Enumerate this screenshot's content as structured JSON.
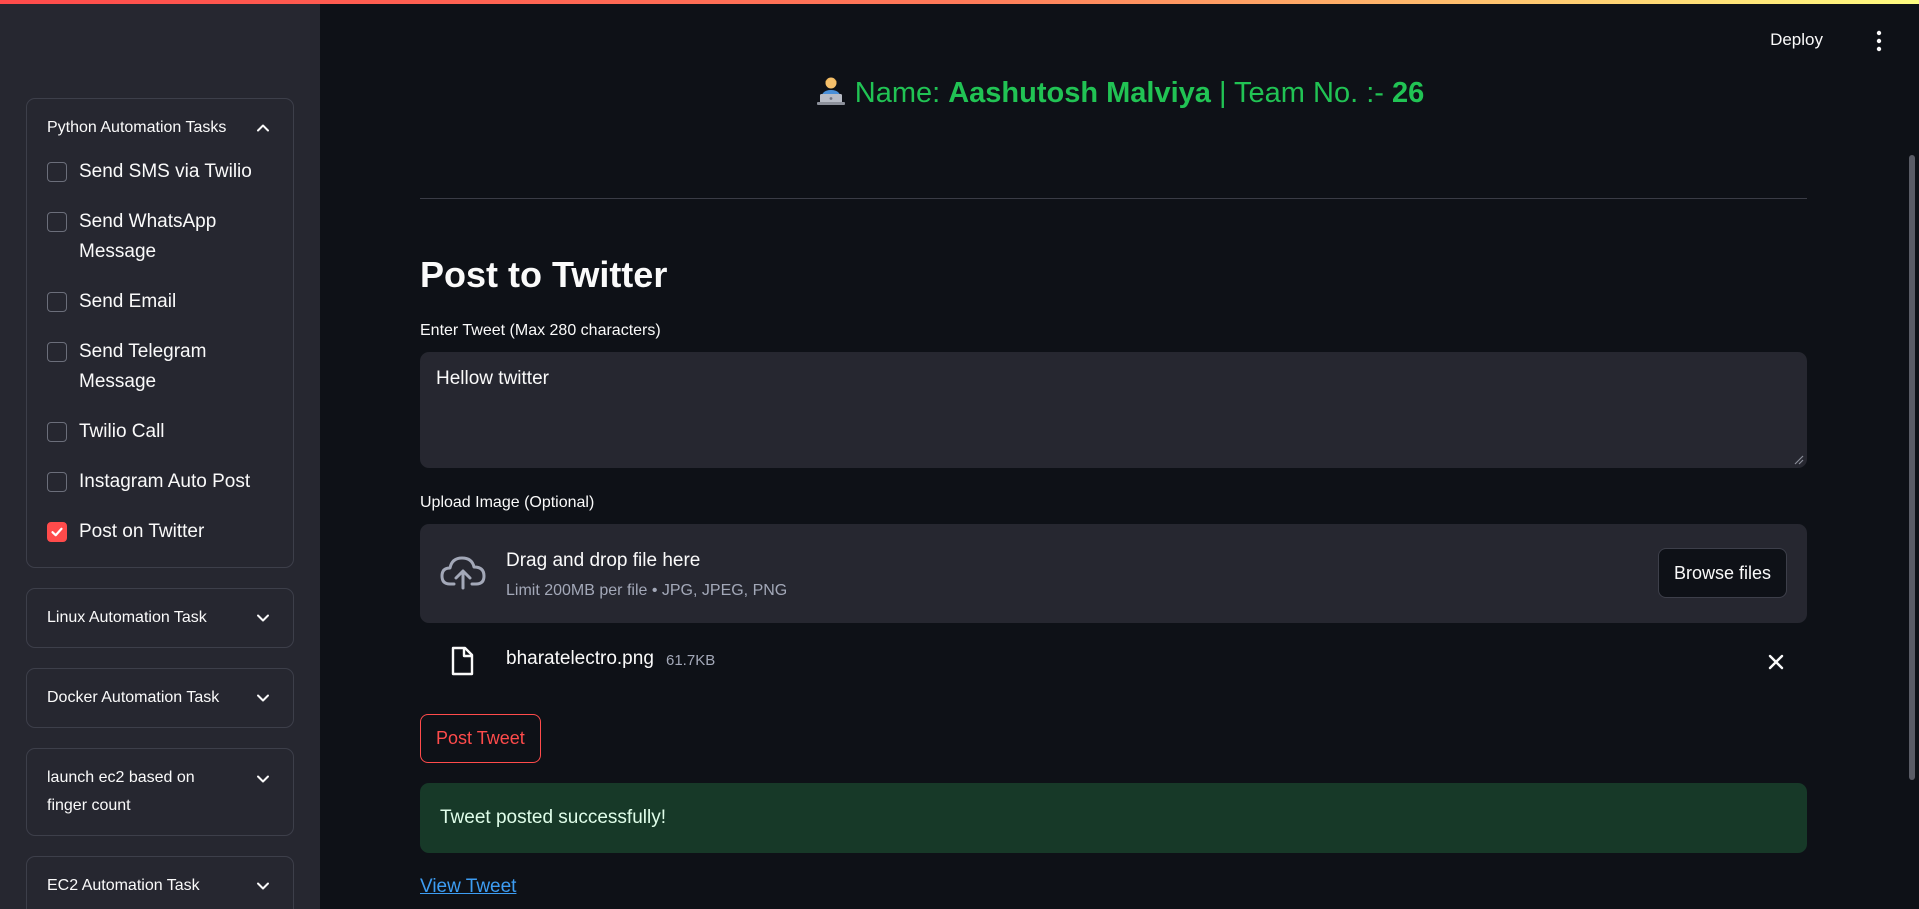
{
  "sidebar": {
    "sections": [
      {
        "title": "Python Automation Tasks",
        "expanded": true,
        "items": [
          {
            "label": "Send SMS via Twilio",
            "checked": false
          },
          {
            "label": "Send WhatsApp Message",
            "checked": false
          },
          {
            "label": "Send Email",
            "checked": false
          },
          {
            "label": "Send Telegram Message",
            "checked": false
          },
          {
            "label": "Twilio Call",
            "checked": false
          },
          {
            "label": "Instagram Auto Post",
            "checked": false
          },
          {
            "label": "Post on Twitter",
            "checked": true
          }
        ]
      },
      {
        "title": "Linux Automation Task",
        "expanded": false
      },
      {
        "title": "Docker Automation Task",
        "expanded": false
      },
      {
        "title": "launch ec2 based on finger count",
        "expanded": false
      },
      {
        "title": "EC2 Automation Task",
        "expanded": false
      }
    ]
  },
  "toolbar": {
    "deploy_label": "Deploy",
    "menu_icon": "kebab-menu-icon"
  },
  "header": {
    "emoji_icon": "technologist-icon",
    "prefix": "Name: ",
    "name": "Aashutosh Malviya",
    "separator": " | Team No. :- ",
    "team": "26",
    "color": "#21c354"
  },
  "main": {
    "page_title": "Post to Twitter",
    "tweet_label": "Enter Tweet (Max 280 characters)",
    "tweet_value": "Hellow twitter",
    "upload_label": "Upload Image (Optional)",
    "dropzone_title": "Drag and drop file here",
    "dropzone_sub": "Limit 200MB per file • JPG, JPEG, PNG",
    "browse_label": "Browse files",
    "file": {
      "name": "bharatelectro.png",
      "size": "61.7KB"
    },
    "post_button": "Post Tweet",
    "success_message": "Tweet posted successfully!",
    "view_link": "View Tweet"
  },
  "colors": {
    "accent": "#ff4b4b",
    "success_bg": "#173928",
    "link": "#3d9df3"
  }
}
